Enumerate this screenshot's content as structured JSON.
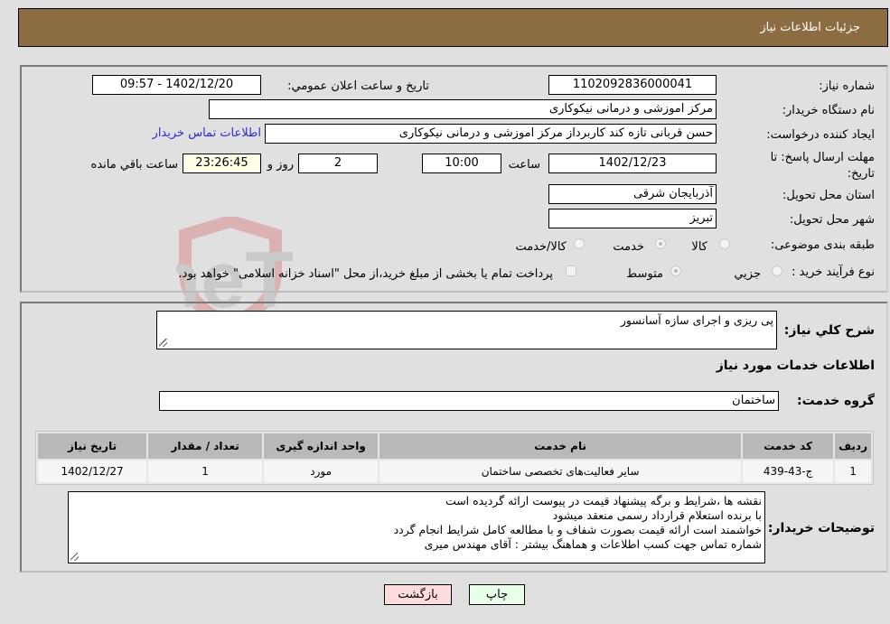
{
  "header": {
    "title": "جزئیات اطلاعات نیاز"
  },
  "details": {
    "need_number_label": "شماره نیاز:",
    "need_number": "1102092836000041",
    "announce_label": "تاریخ و ساعت اعلان عمومي:",
    "announce_value": "1402/12/20 - 09:57",
    "buyer_org_label": "نام دستگاه خریدار:",
    "buyer_org": "مرکز اموزشی و درمانی نیکوکاری",
    "creator_label": "ایجاد کننده درخواست:",
    "creator": "حسن قربانی تازه کند کاربرداز مرکز اموزشی و درمانی نیکوکاری",
    "contact_link": "اطلاعات تماس خریدار",
    "deadline_label": "مهلت ارسال پاسخ: تا تاریخ:",
    "deadline_date": "1402/12/23",
    "time_label": "ساعت",
    "deadline_time": "10:00",
    "days_value": "2",
    "days_label": "روز و",
    "remaining_value": "23:26:45",
    "remaining_label": "ساعت باقي مانده",
    "province_label": "استان محل تحویل:",
    "province": "آذربایجان شرقی",
    "city_label": "شهر محل تحویل:",
    "city": "تبریز",
    "category_label": "طبقه بندی موضوعی:",
    "category_options": [
      {
        "label": "کالا",
        "selected": false
      },
      {
        "label": "خدمت",
        "selected": true
      },
      {
        "label": "کالا/خدمت",
        "selected": false
      }
    ],
    "process_label": "نوع فرآیند خرید :",
    "process_options": [
      {
        "label": "جزيي",
        "selected": false
      },
      {
        "label": "متوسط",
        "selected": true
      }
    ],
    "treasury_note": "پرداخت تمام یا بخشی از مبلغ خرید،از محل \"اسناد خزانه اسلامی\" خواهد بود.",
    "treasury_checked": false
  },
  "services": {
    "summary_label": "شرح کلي نیاز:",
    "summary": "پی ریزی و اجرای سازه آسانسور",
    "section_title": "اطلاعات خدمات مورد نیاز",
    "group_label": "گروه خدمت:",
    "group": "ساختمان",
    "table": {
      "headers": [
        "ردیف",
        "کد خدمت",
        "نام خدمت",
        "واحد اندازه گیری",
        "تعداد / مقدار",
        "تاریخ نیاز"
      ],
      "rows": [
        [
          "1",
          "ج-43-439",
          "سایر فعالیت‌های تخصصی ساختمان",
          "مورد",
          "1",
          "1402/12/27"
        ]
      ]
    },
    "buyer_notes_label": "توضیحات خریدار:",
    "buyer_notes": [
      "نقشه ها ،شرایط و برگه پیشنهاد قیمت در پیوست ارائه گردیده است",
      "با برنده استعلام قرارداد رسمی منعقد میشود",
      "خواشمند است ارائه قیمت بصورت شفاف و با مطالعه کامل شرایط انجام گردد",
      "شماره تماس جهت کسب اطلاعات و هماهنگ بیشتر : آقای مهندس میری"
    ]
  },
  "buttons": {
    "print": "چاپ",
    "back": "بازگشت"
  },
  "colors": {
    "header_bg": "#8c6d41",
    "print_bg": "#eaffea",
    "back_bg": "#ffdcdc",
    "link": "#2b2bd4"
  },
  "watermark": "AriaTender.neT"
}
